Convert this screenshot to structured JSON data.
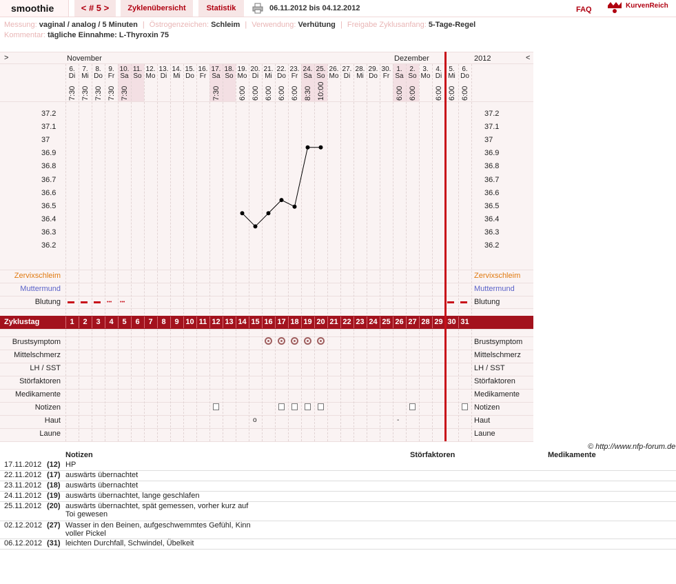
{
  "header": {
    "user": "smoothie",
    "cycle": "< # 5 >",
    "tab_overview": "Zyklenübersicht",
    "tab_stats": "Statistik",
    "daterange": "06.11.2012 bis 04.12.2012",
    "faq": "FAQ",
    "logo_text": "KurvenReich"
  },
  "info": {
    "messung_label": "Messung:",
    "messung_value": "vaginal / analog / 5 Minuten",
    "oestrogen_label": "Östrogenzeichen:",
    "oestrogen_value": "Schleim",
    "verwendung_label": "Verwendung:",
    "verwendung_value": "Verhütung",
    "freigabe_label": "Freigabe Zyklusanfang:",
    "freigabe_value": "5-Tage-Regel",
    "kommentar_label": "Kommentar:",
    "kommentar_value": "tägliche Einnahme: L-Thyroxin 75"
  },
  "grid": {
    "nav_left": ">",
    "nav_right": "<",
    "month1": "November",
    "month2": "Dezember",
    "year": "2012",
    "days": [
      {
        "d": "6.",
        "w": "Di",
        "t": "7:30",
        "we": false
      },
      {
        "d": "7.",
        "w": "Mi",
        "t": "7:30",
        "we": false
      },
      {
        "d": "8.",
        "w": "Do",
        "t": "7:30",
        "we": false
      },
      {
        "d": "9.",
        "w": "Fr",
        "t": "7:30",
        "we": false
      },
      {
        "d": "10.",
        "w": "Sa",
        "t": "7:30",
        "we": true
      },
      {
        "d": "11.",
        "w": "So",
        "t": "",
        "we": true
      },
      {
        "d": "12.",
        "w": "Mo",
        "t": "",
        "we": false
      },
      {
        "d": "13.",
        "w": "Di",
        "t": "",
        "we": false
      },
      {
        "d": "14.",
        "w": "Mi",
        "t": "",
        "we": false
      },
      {
        "d": "15.",
        "w": "Do",
        "t": "",
        "we": false
      },
      {
        "d": "16.",
        "w": "Fr",
        "t": "",
        "we": false
      },
      {
        "d": "17.",
        "w": "Sa",
        "t": "7:30",
        "we": true
      },
      {
        "d": "18.",
        "w": "So",
        "t": "",
        "we": true
      },
      {
        "d": "19.",
        "w": "Mo",
        "t": "6:00",
        "we": false
      },
      {
        "d": "20.",
        "w": "Di",
        "t": "6:00",
        "we": false
      },
      {
        "d": "21.",
        "w": "Mi",
        "t": "6:00",
        "we": false
      },
      {
        "d": "22.",
        "w": "Do",
        "t": "6:00",
        "we": false
      },
      {
        "d": "23.",
        "w": "Fr",
        "t": "6:00",
        "we": false
      },
      {
        "d": "24.",
        "w": "Sa",
        "t": "8:30",
        "we": true
      },
      {
        "d": "25.",
        "w": "So",
        "t": "10:00",
        "we": true
      },
      {
        "d": "26.",
        "w": "Mo",
        "t": "",
        "we": false
      },
      {
        "d": "27.",
        "w": "Di",
        "t": "",
        "we": false
      },
      {
        "d": "28.",
        "w": "Mi",
        "t": "",
        "we": false
      },
      {
        "d": "29.",
        "w": "Do",
        "t": "",
        "we": false
      },
      {
        "d": "30.",
        "w": "Fr",
        "t": "",
        "we": false
      },
      {
        "d": "1.",
        "w": "Sa",
        "t": "6:00",
        "we": true
      },
      {
        "d": "2.",
        "w": "So",
        "t": "6:00",
        "we": true
      },
      {
        "d": "3.",
        "w": "Mo",
        "t": "",
        "we": false
      },
      {
        "d": "4.",
        "w": "Di",
        "t": "6:00",
        "we": false
      },
      {
        "d": "5.",
        "w": "Mi",
        "t": "6:00",
        "we": false
      },
      {
        "d": "6.",
        "w": "Do",
        "t": "6:00",
        "we": false
      }
    ],
    "temps": [
      "37.2",
      "37.1",
      "37",
      "36.9",
      "36.8",
      "36.7",
      "36.6",
      "36.5",
      "36.4",
      "36.3",
      "36.2"
    ],
    "rows_top": [
      "Zervixschleim",
      "Muttermund",
      "Blutung"
    ],
    "zyklustag_label": "Zyklustag",
    "cycle_days": [
      "1",
      "2",
      "3",
      "4",
      "5",
      "6",
      "7",
      "8",
      "9",
      "10",
      "11",
      "12",
      "13",
      "14",
      "15",
      "16",
      "17",
      "18",
      "19",
      "20",
      "21",
      "22",
      "23",
      "24",
      "25",
      "26",
      "27",
      "28",
      "29",
      "30",
      "31"
    ],
    "rows_bottom": [
      "Brustsymptom",
      "Mittelschmerz",
      "LH / SST",
      "Störfaktoren",
      "Medikamente",
      "Notizen",
      "Haut",
      "Laune"
    ],
    "haut_marks": [
      "o",
      "-"
    ]
  },
  "chart_data": {
    "type": "line",
    "xlabel": "",
    "ylabel": "",
    "ylim": [
      36.2,
      37.2
    ],
    "x": [
      14,
      15,
      16,
      17,
      18,
      19,
      20
    ],
    "values": [
      36.45,
      36.35,
      36.45,
      36.55,
      36.5,
      36.95,
      36.95
    ],
    "colors": {
      "line": "#000000",
      "accent": "#b00010"
    }
  },
  "copyright": "© http://www.nfp-forum.de",
  "notes": {
    "headers": [
      "Notizen",
      "Störfaktoren",
      "Medikamente"
    ],
    "rows": [
      {
        "date": "17.11.2012",
        "day": "(12)",
        "text": "HP"
      },
      {
        "date": "22.11.2012",
        "day": "(17)",
        "text": "auswärts übernachtet"
      },
      {
        "date": "23.11.2012",
        "day": "(18)",
        "text": "auswärts übernachtet"
      },
      {
        "date": "24.11.2012",
        "day": "(19)",
        "text": "auswärts übernachtet, lange geschlafen"
      },
      {
        "date": "25.11.2012",
        "day": "(20)",
        "text": "auswärts übernachtet, spät gemessen, vorher kurz auf Toi gewesen"
      },
      {
        "date": "02.12.2012",
        "day": "(27)",
        "text": "Wasser in den Beinen, aufgeschwemmtes Gefühl, Kinn voller Pickel"
      },
      {
        "date": "06.12.2012",
        "day": "(31)",
        "text": "leichten Durchfall, Schwindel, Übelkeit"
      }
    ]
  }
}
